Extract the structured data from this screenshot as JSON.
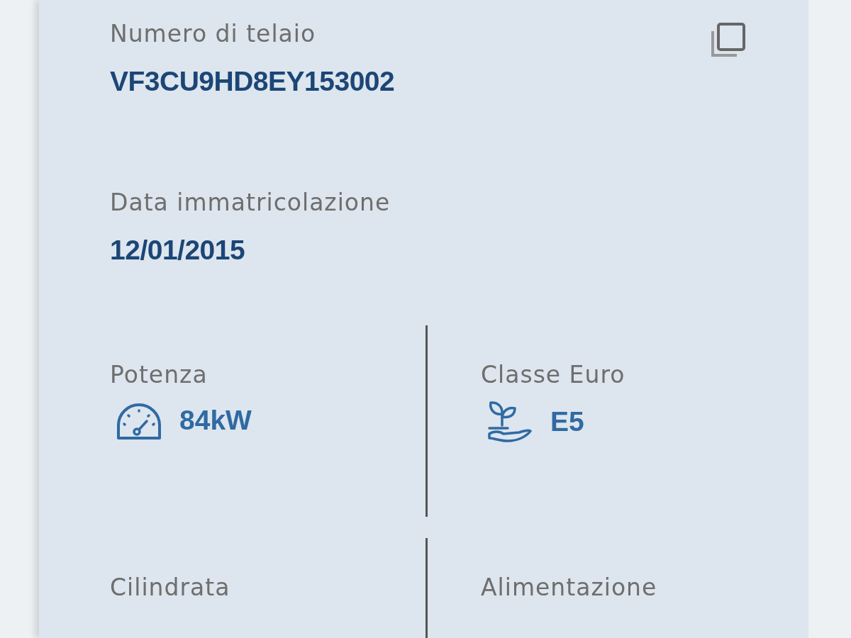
{
  "vin": {
    "label": "Numero di telaio",
    "value": "VF3CU9HD8EY153002"
  },
  "registration": {
    "label": "Data immatricolazione",
    "value": "12/01/2015"
  },
  "specs": [
    {
      "label": "Potenza",
      "value": "84kW",
      "kind": "power"
    },
    {
      "label": "Classe Euro",
      "value": "E5",
      "kind": "euro"
    },
    {
      "label": "Cilindrata"
    },
    {
      "label": "Alimentazione"
    }
  ]
}
